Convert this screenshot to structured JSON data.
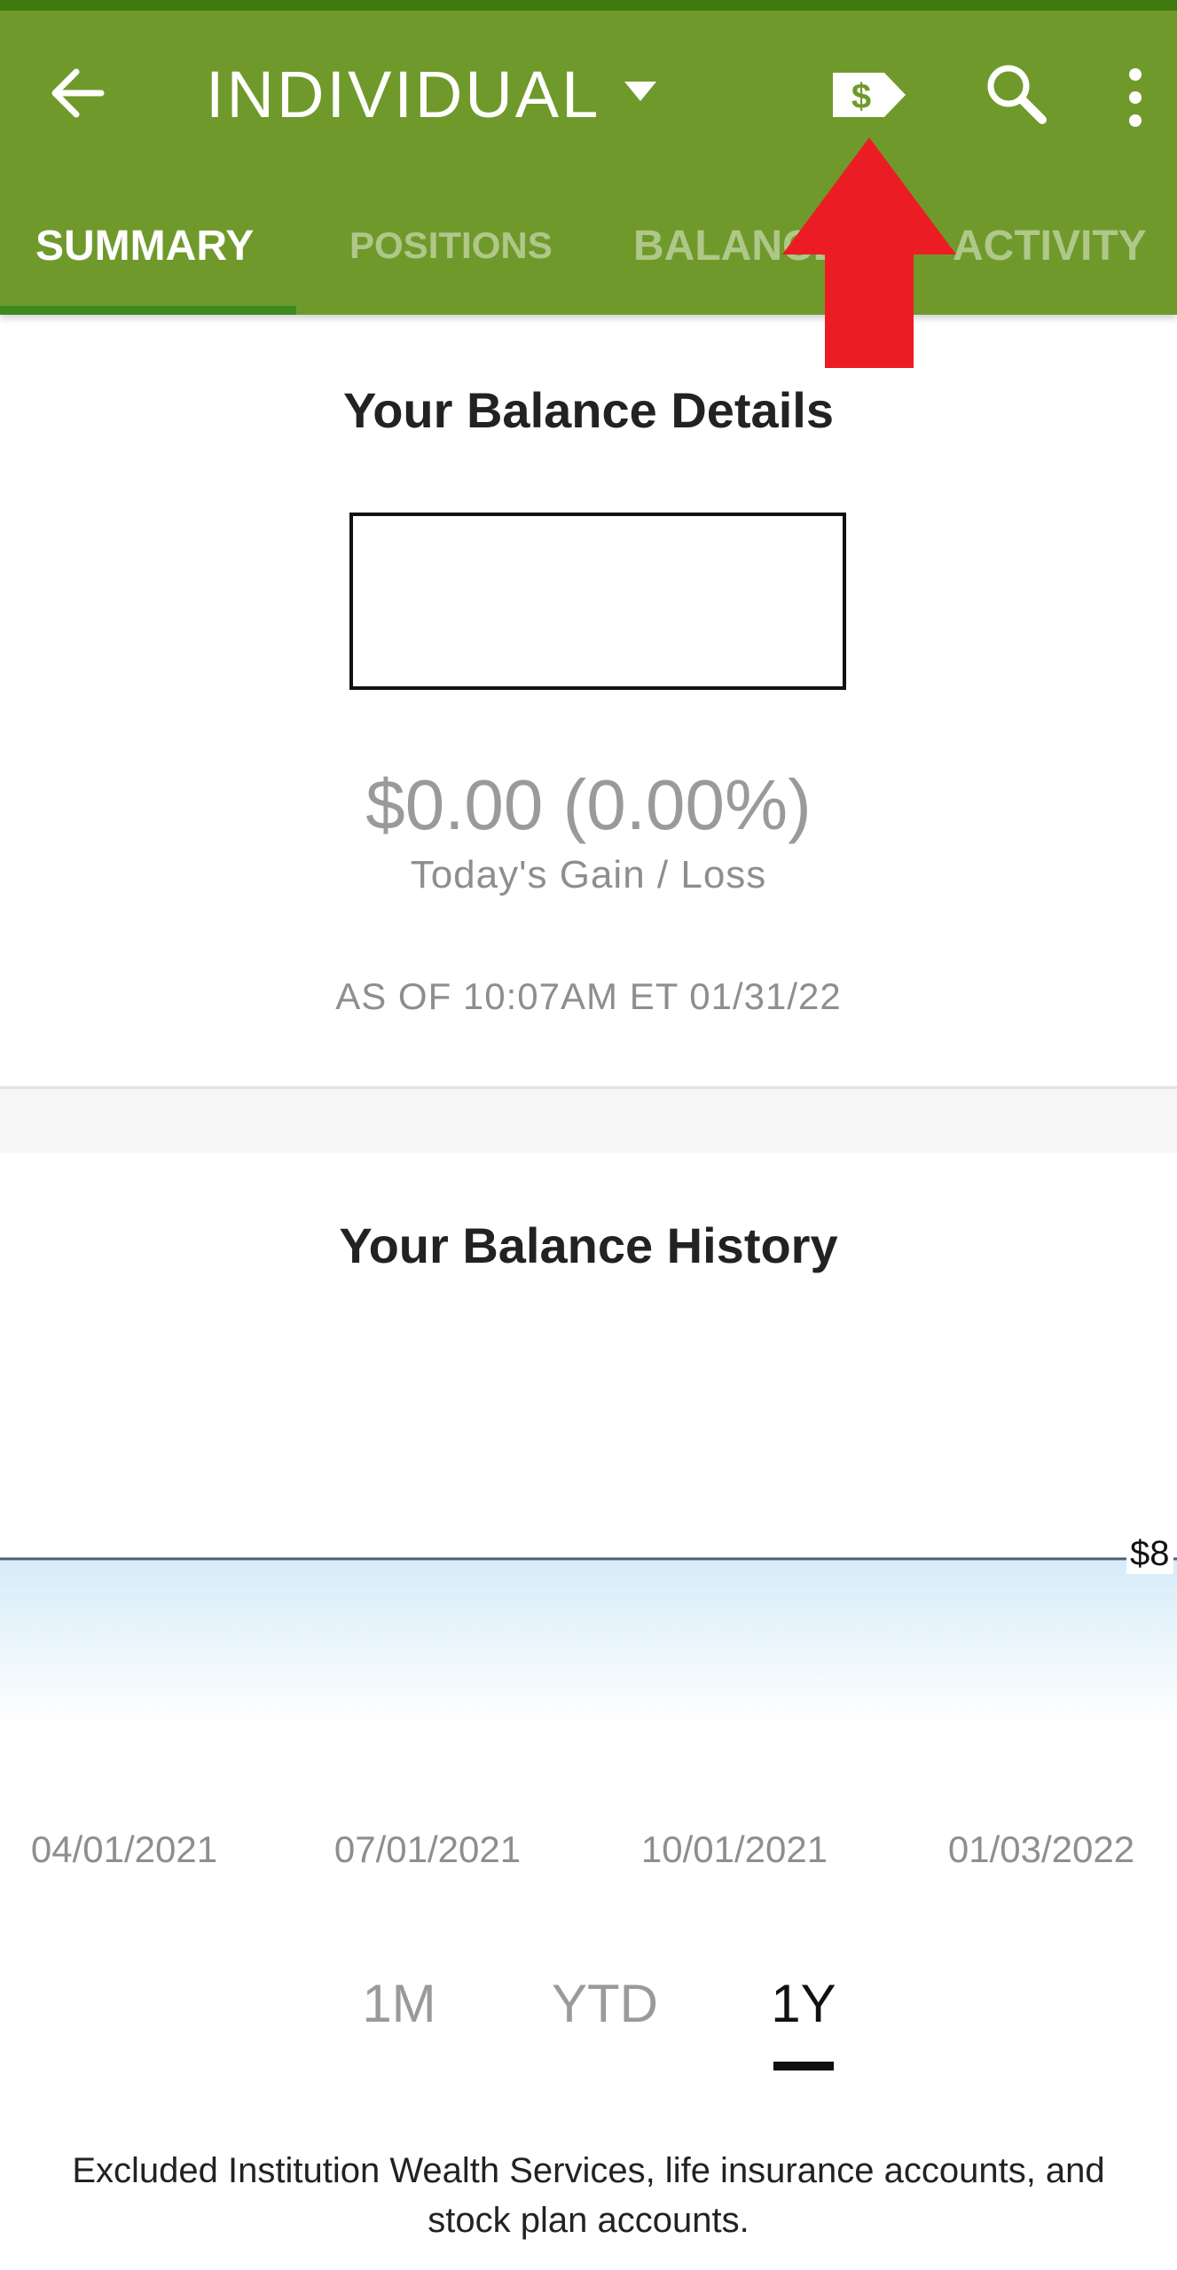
{
  "app_bar": {
    "title": "INDIVIDUAL",
    "back_icon": "arrow-left-icon",
    "dropdown_icon": "caret-down-icon",
    "transfer_icon": "dollar-tag-icon",
    "search_icon": "search-icon",
    "more_icon": "more-vertical-icon",
    "color": "#6f9a2b"
  },
  "tabs": [
    {
      "label": "SUMMARY",
      "active": true
    },
    {
      "label": "POSITIONS",
      "active": false
    },
    {
      "label": "BALANCES",
      "active": false
    },
    {
      "label": "ACTIVITY",
      "active": false
    }
  ],
  "annotation": {
    "type": "red-arrow",
    "color": "#ec1c24",
    "points_to": "transfer-icon"
  },
  "balance_details": {
    "title": "Your Balance Details",
    "gain_value": "$0.00 (0.00%)",
    "gain_label": "Today's Gain / Loss",
    "as_of": "AS OF 10:07AM ET 01/31/22"
  },
  "balance_history": {
    "title": "Your Balance History",
    "value_label": "$8",
    "x_labels": [
      "04/01/2021",
      "07/01/2021",
      "10/01/2021",
      "01/03/2022"
    ],
    "ranges": [
      {
        "label": "1M",
        "active": false
      },
      {
        "label": "YTD",
        "active": false
      },
      {
        "label": "1Y",
        "active": true
      }
    ],
    "line_color": "#4a5f74",
    "fill_color": "#d6ecf8"
  },
  "footnote": "Excluded Institution Wealth Services, life insurance accounts, and stock plan accounts."
}
